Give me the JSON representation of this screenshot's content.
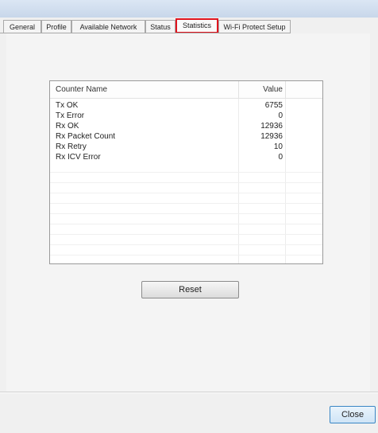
{
  "tabs": [
    {
      "label": "General"
    },
    {
      "label": "Profile"
    },
    {
      "label": "Available Network"
    },
    {
      "label": "Status"
    },
    {
      "label": "Statistics",
      "active": true
    },
    {
      "label": "Wi-Fi Protect Setup"
    }
  ],
  "table": {
    "headers": {
      "name": "Counter Name",
      "value": "Value"
    },
    "rows": [
      {
        "name": "Tx OK",
        "value": "6755"
      },
      {
        "name": "Tx Error",
        "value": "0"
      },
      {
        "name": "Rx OK",
        "value": "12936"
      },
      {
        "name": "Rx Packet Count",
        "value": "12936"
      },
      {
        "name": "Rx Retry",
        "value": "10"
      },
      {
        "name": "Rx ICV Error",
        "value": "0"
      }
    ]
  },
  "buttons": {
    "reset": "Reset",
    "close": "Close"
  },
  "colors": {
    "active_tab_border": "#e0151f",
    "close_button_border": "#3a86c4"
  }
}
